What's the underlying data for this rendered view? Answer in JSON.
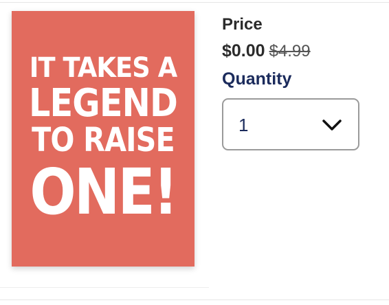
{
  "product": {
    "card_lines": [
      "IT TAKES A",
      "LEGEND",
      "TO RAISE",
      "ONE!"
    ],
    "card_color": "#e26b5e"
  },
  "pricing": {
    "label": "Price",
    "current": "$0.00",
    "original": "$4.99"
  },
  "quantity": {
    "label": "Quantity",
    "selected": "1",
    "icon": "chevron-down-icon"
  }
}
